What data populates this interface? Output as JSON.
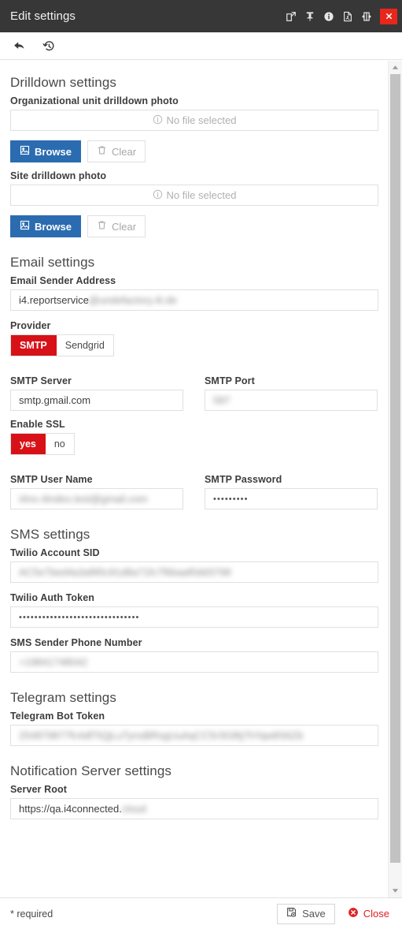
{
  "window": {
    "title": "Edit settings",
    "actions": [
      {
        "name": "popout-icon",
        "label": "Open in new window"
      },
      {
        "name": "pin-icon",
        "label": "Pin"
      },
      {
        "name": "info-icon",
        "label": "Info"
      },
      {
        "name": "pdf-icon",
        "label": "Export PDF"
      },
      {
        "name": "resize-icon",
        "label": "Resize"
      }
    ],
    "close_label": "x"
  },
  "toolbar": {
    "back_label": "Back",
    "reset_label": "Reset"
  },
  "sections": {
    "drilldown": {
      "title": "Drilldown settings",
      "fields": [
        {
          "label": "Organizational unit drilldown photo",
          "value": "No file selected",
          "browse_label": "Browse",
          "clear_label": "Clear"
        },
        {
          "label": "Site drilldown photo",
          "value": "No file selected",
          "browse_label": "Browse",
          "clear_label": "Clear"
        }
      ]
    },
    "email": {
      "title": "Email settings",
      "sender_label": "Email Sender Address",
      "sender_value_visible": "i4.reportservice",
      "sender_value_redacted": "@undefactory.4i.de",
      "provider_label": "Provider",
      "provider_options": [
        "SMTP",
        "Sendgrid"
      ],
      "provider_selected": "SMTP",
      "smtp_server_label": "SMTP Server",
      "smtp_server_value": "smtp.gmail.com",
      "smtp_port_label": "SMTP Port",
      "smtp_port_value_redacted": "587",
      "ssl_label": "Enable SSL",
      "ssl_options": [
        "yes",
        "no"
      ],
      "ssl_selected": "yes",
      "user_label": "SMTP User Name",
      "user_value_redacted": "i4no.4index.test@gmail.com",
      "password_label": "SMTP Password",
      "password_value": "•••••••••"
    },
    "sms": {
      "title": "SMS settings",
      "sid_label": "Twilio Account SID",
      "sid_value_redacted": "AC5e7bed4a3af95c91d8a71fc7f6baaf0dd3798",
      "token_label": "Twilio Auth Token",
      "token_value": "•••••••••••••••••••••••••••••••",
      "phone_label": "SMS Sender Phone Number",
      "phone_value_redacted": "+19841748042"
    },
    "telegram": {
      "title": "Telegram settings",
      "bot_token_label": "Telegram Bot Token",
      "bot_token_value_redacted": "254879877fc4df7tQjLuTynsBRsgUuAqCC5r3G8tj7hYqw8S6Zb"
    },
    "notification": {
      "title": "Notification Server settings",
      "server_root_label": "Server Root",
      "server_root_value_visible": "https://qa.i4connected.",
      "server_root_value_redacted": "cloud"
    }
  },
  "footer": {
    "required_note": "* required",
    "save_label": "Save",
    "close_label": "Close"
  },
  "colors": {
    "titlebar_bg": "#373737",
    "accent_red": "#d81118",
    "close_red": "#e8261c",
    "browse_blue": "#2b6cb0"
  }
}
